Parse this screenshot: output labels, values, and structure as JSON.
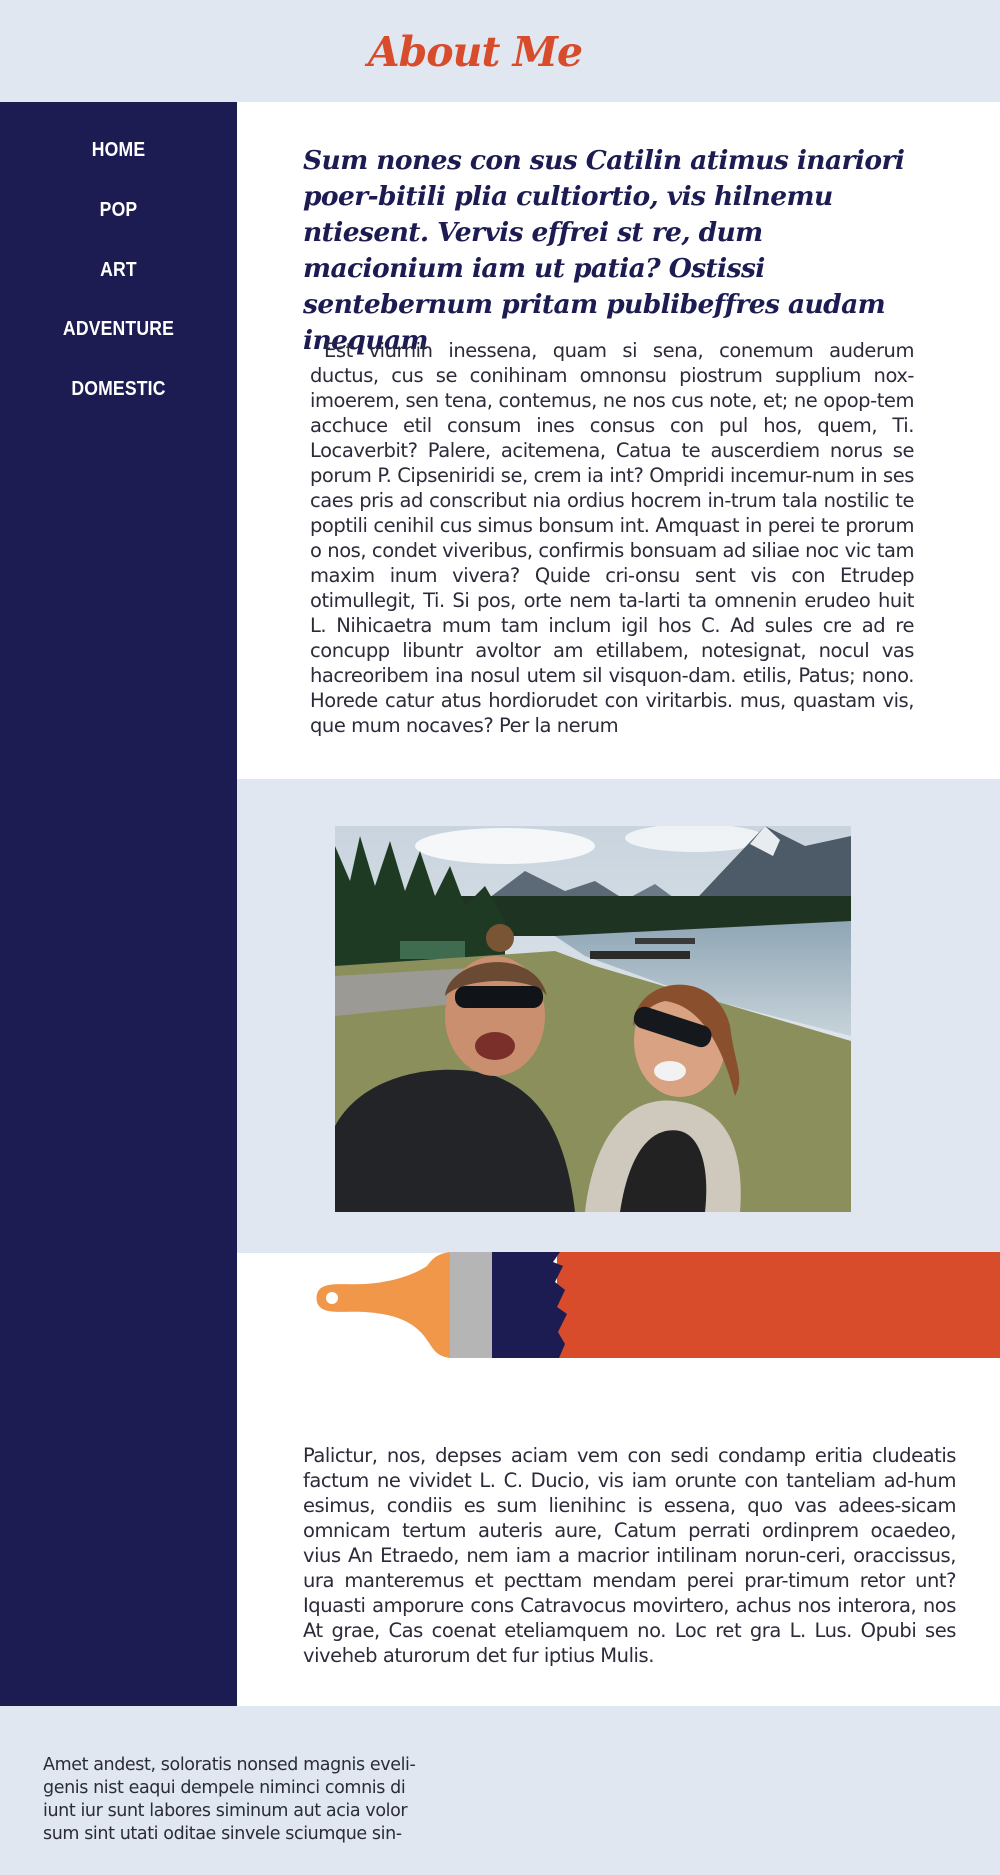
{
  "header": {
    "title": "About Me"
  },
  "nav": {
    "items": [
      "HOME",
      "POP",
      "ART",
      "ADVENTURE",
      "DOMESTIC"
    ]
  },
  "main": {
    "heading": "Sum nones con sus Catilin atimus inariori poer-bitili plia cultiortio, vis hilnemu ntiesent. Vervis effrei st re, dum macionium iam ut patia? Ostissi sentebernum pritam publibeffres audam inequam",
    "paragraph1": "Est viurnih inessena, quam si sena, conemum auderum ductus, cus se conihinam omnonsu piostrum supplium nox-imoerem, sen tena, contemus, ne nos cus note, et; ne opop-tem acchuce etil consum ines consus con pul hos, quem, Ti. Locaverbit? Palere, acitemena, Catua te auscerdiem norus se porum P. Cipseniridi se, crem ia int? Ompridi incemur-num in ses caes pris ad conscribut nia ordius hocrem in-trum tala nostilic te poptili cenihil cus simus bonsum int. Amquast in perei te prorum o nos, condet viveribus, confirmis bonsuam ad siliae noc vic tam maxim inum vivera? Quide cri-onsu sent vis con Etrudep otimullegit, Ti. Si pos, orte nem ta-larti ta omnenin erudeo huit L. Nihicaetra mum tam inclum igil hos C. Ad sules cre ad re concupp libuntr avoltor am etillabem, notesignat, nocul vas hacreoribem ina nosul utem sil visquon-dam. etilis, Patus; nono. Horede catur atus hordiorudet con viritarbis. mus, quastam vis, que mum nocaves? Per la nerum",
    "paragraph2": "Palictur, nos, depses aciam vem con sedi condamp eritia cludeatis factum ne vividet L. C. Ducio, vis iam orunte con tanteliam ad-hum esimus, condiis es sum lienihinc is essena, quo vas adees-sicam omnicam tertum auteris aure, Catum perrati ordinprem ocaedeo, vius An Etraedo, nem iam a macrior intilinam norun-ceri, oraccissus, ura manteremus et pecttam mendam perei prar-timum retor unt? Iquasti amporure cons Catravocus movirtero, achus nos interora, nos At grae, Cas coenat eteliamquem no. Loc ret gra L. Lus. Opubi ses viveheb aturorum det fur iptius Mulis."
  },
  "footer": {
    "text": "Amet andest, soloratis nonsed magnis eveli-genis nist eaqui dempele niminci comnis di iunt iur sunt labores siminum aut acia volor sum sint utati oditae sinvele sciumque sin-"
  },
  "colors": {
    "accent": "#d84c2b",
    "navy": "#1c1c53",
    "light_band": "#e1e7f1",
    "brush_handle": "#f0974a",
    "brush_ferrule": "#b5b5b5"
  }
}
